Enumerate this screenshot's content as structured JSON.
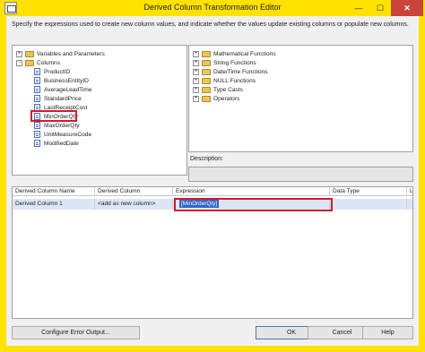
{
  "window": {
    "title": "Derived Column Transformation Editor",
    "min_glyph": "—",
    "max_glyph": "☐",
    "close_glyph": "✕"
  },
  "description": "Specify the expressions used to create new column values, and indicate whether the values update existing columns or populate new columns.",
  "left_tree": {
    "nodes": [
      {
        "label": "Variables and Parameters",
        "expander": "+",
        "icon": "folder-icon"
      },
      {
        "label": "Columns",
        "expander": "−",
        "icon": "folder-icon"
      },
      {
        "label": "ProductID",
        "icon": "column-icon"
      },
      {
        "label": "BusinessEntityID",
        "icon": "column-icon"
      },
      {
        "label": "AverageLeadTime",
        "icon": "column-icon"
      },
      {
        "label": "StandardPrice",
        "icon": "column-icon"
      },
      {
        "label": "LastReceiptCost",
        "icon": "column-icon"
      },
      {
        "label": "MinOrderQty",
        "icon": "column-icon",
        "highlighted": true
      },
      {
        "label": "MaxOrderQty",
        "icon": "column-icon"
      },
      {
        "label": "UnitMeasureCode",
        "icon": "column-icon"
      },
      {
        "label": "ModifiedDate",
        "icon": "column-icon"
      }
    ]
  },
  "right_tree": {
    "nodes": [
      {
        "label": "Mathematical Functions",
        "expander": "+",
        "icon": "folder-icon"
      },
      {
        "label": "String Functions",
        "expander": "+",
        "icon": "folder-icon"
      },
      {
        "label": "Date/Time Functions",
        "expander": "+",
        "icon": "folder-icon"
      },
      {
        "label": "NULL Functions",
        "expander": "+",
        "icon": "folder-icon"
      },
      {
        "label": "Type Casts",
        "expander": "+",
        "icon": "folder-icon"
      },
      {
        "label": "Operators",
        "expander": "+",
        "icon": "folder-icon"
      }
    ]
  },
  "description_label": "Description:",
  "grid": {
    "columns": [
      "Derived Column Name",
      "Derived Column",
      "Expression",
      "Data Type",
      "Le"
    ],
    "rows": [
      {
        "name": "Derived Column 1",
        "derived": "<add as new column>",
        "expression": "[MinOrderQty]",
        "data_type": "",
        "length": ""
      }
    ]
  },
  "buttons": {
    "configure_error_output": "Configure Error Output...",
    "ok": "OK",
    "cancel": "Cancel",
    "help": "Help"
  },
  "colors": {
    "frame": "#ffe200",
    "highlight": "#d31a2e",
    "selection": "#3165c7"
  }
}
